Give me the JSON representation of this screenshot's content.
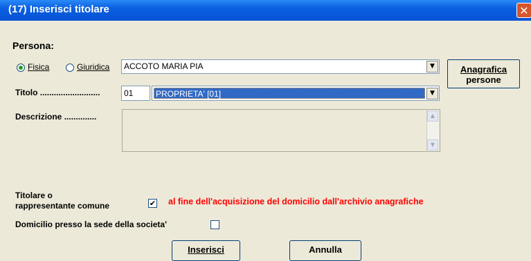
{
  "window": {
    "title": "(17) Inserisci titolare",
    "close_symbol": "✕"
  },
  "persona": {
    "heading": "Persona:",
    "radio_fisica": "Fisica",
    "radio_giuridica": "Giuridica",
    "selected_type": "Fisica",
    "name_value": "ACCOTO MARIA PIA"
  },
  "anagrafica_button": {
    "line1": "Anagrafica",
    "line2": "persone"
  },
  "titolo": {
    "label": "Titolo ..........................",
    "code": "01",
    "value": "PROPRIETA' [01]"
  },
  "descrizione": {
    "label": "Descrizione ..............",
    "value": ""
  },
  "titolare": {
    "label_line1": "Titolare o",
    "label_line2": "rappresentante comune",
    "checked": true,
    "note": "al fine dell'acquisizione del domicilio dall'archivio anagrafiche",
    "note_color": "#FF0000"
  },
  "domicilio": {
    "label": "Domicilio presso la sede della societa'",
    "checked": false
  },
  "buttons": {
    "inserisci": "Inserisci",
    "annulla": "Annulla"
  },
  "colors": {
    "titlebar": "#0A5FE0",
    "selection": "#316AC5",
    "panel": "#ECE9D8"
  }
}
